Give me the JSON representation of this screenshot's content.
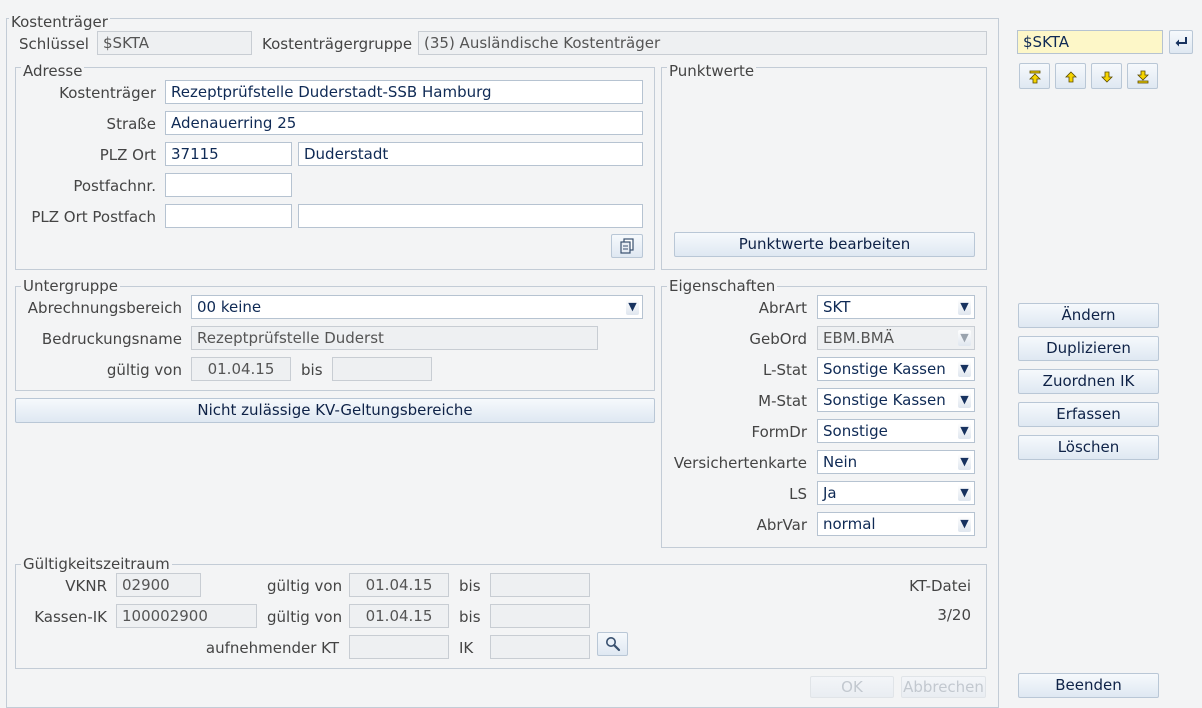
{
  "kostentraeger": {
    "legend": "Kostenträger",
    "schluessel_label": "Schlüssel",
    "schluessel_value": "$SKTA",
    "gruppe_label": "Kostenträgergruppe",
    "gruppe_value": "(35) Ausländische Kostenträger"
  },
  "adresse": {
    "legend": "Adresse",
    "kt_label": "Kostenträger",
    "kt_value": "Rezeptprüfstelle Duderstadt-SSB Hamburg",
    "strasse_label": "Straße",
    "strasse_value": "Adenauerring 25",
    "plzort_label": "PLZ Ort",
    "plz_value": "37115",
    "ort_value": "Duderstadt",
    "postfach_label": "Postfachnr.",
    "postfach_value": "",
    "plzpostfach_label": "PLZ Ort Postfach",
    "plzpostfach_plz": "",
    "plzpostfach_ort": ""
  },
  "punktwerte": {
    "legend": "Punktwerte",
    "button": "Punktwerte bearbeiten"
  },
  "untergruppe": {
    "legend": "Untergruppe",
    "abrechnung_label": "Abrechnungsbereich",
    "abrechnung_value": "00 keine",
    "bedruckung_label": "Bedruckungsname",
    "bedruckung_value": "Rezeptprüfstelle Duderst",
    "gueltig_label": "gültig von",
    "gueltig_von": "01.04.15",
    "bis_label": "bis",
    "bis_value": ""
  },
  "kv_button": "Nicht zulässige KV-Geltungsbereiche",
  "eigenschaften": {
    "legend": "Eigenschaften",
    "rows": [
      {
        "label": "AbrArt",
        "value": "SKT"
      },
      {
        "label": "GebOrd",
        "value": "EBM.BMÄ"
      },
      {
        "label": "L-Stat",
        "value": "Sonstige Kassen"
      },
      {
        "label": "M-Stat",
        "value": "Sonstige Kassen"
      },
      {
        "label": "FormDr",
        "value": "Sonstige"
      },
      {
        "label": "Versichertenkarte",
        "value": "Nein"
      },
      {
        "label": "LS",
        "value": "Ja"
      },
      {
        "label": "AbrVar",
        "value": "normal"
      }
    ]
  },
  "gueltigkeit": {
    "legend": "Gültigkeitszeitraum",
    "vknr_label": "VKNR",
    "vknr_value": "02900",
    "gueltig_label": "gültig von",
    "gueltig1_von": "01.04.15",
    "bis_label": "bis",
    "gueltig1_bis": "",
    "kassenik_label": "Kassen-IK",
    "kassenik_value": "100002900",
    "gueltig2_von": "01.04.15",
    "gueltig2_bis": "",
    "aufnehmend_label": "aufnehmender KT",
    "aufnehmend_value": "",
    "ik_label": "IK",
    "ik_value": "",
    "ktdatei_label": "KT-Datei",
    "ktdatei_value": "3/20"
  },
  "search": {
    "value": "$SKTA"
  },
  "actions": {
    "aendern": "Ändern",
    "duplizieren": "Duplizieren",
    "zuordnen": "Zuordnen IK",
    "erfassen": "Erfassen",
    "loeschen": "Löschen",
    "beenden": "Beenden"
  },
  "footer": {
    "ok": "OK",
    "abbrechen": "Abbrechen"
  },
  "colors": {
    "input_text": "#0f2a55",
    "search_bg": "#fdf7c8",
    "nav_arrow": "#f5d400"
  }
}
